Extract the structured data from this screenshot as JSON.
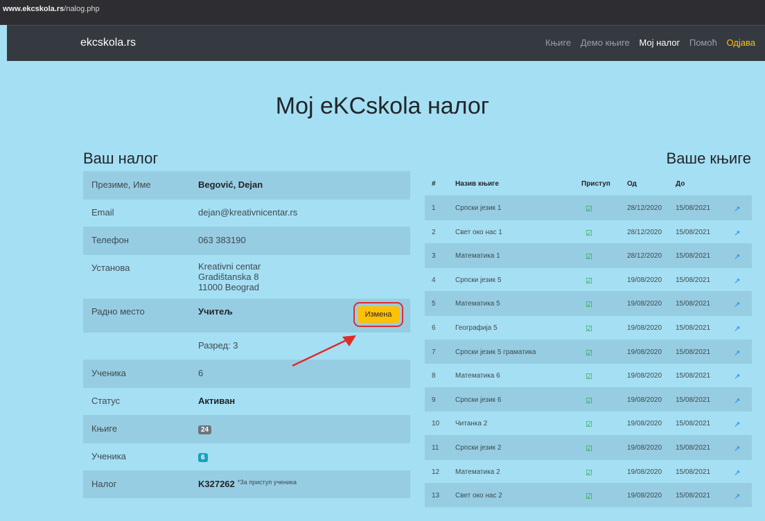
{
  "browser": {
    "url_host": "www.ekcskola.rs",
    "url_path": "/nalog.php"
  },
  "nav": {
    "brand": "ekcskola.rs",
    "links": [
      "Књиге",
      "Демо књиге",
      "Мој налог",
      "Помоћ",
      "Одјава"
    ]
  },
  "page": {
    "title": "Moj eKCskola налог"
  },
  "account": {
    "heading": "Ваш налог",
    "name_label": "Презиме, Име",
    "name": "Begović, Dejan",
    "email_label": "Email",
    "email": "dejan@kreativnicentar.rs",
    "phone_label": "Телефон",
    "phone": "063 383190",
    "inst_label": "Установа",
    "inst_lines": [
      "Kreativni centar",
      "Gradištanska 8",
      "11000 Beograd"
    ],
    "role_label": "Радно место",
    "role": "Учитељ",
    "edit_button": "Измена",
    "grade": "Разред: 3",
    "students_label": "Ученика",
    "students": "6",
    "status_label": "Статус",
    "status": "Активан",
    "books_label": "Књиге",
    "books_count": "24",
    "students2_label": "Ученика",
    "students2_count": "6",
    "account_label": "Налог",
    "account_code": "K327262",
    "account_note": "*За приступ ученика"
  },
  "books": {
    "heading": "Ваше књиге",
    "columns": [
      "#",
      "Назив књиге",
      "Приступ",
      "Од",
      "До"
    ],
    "rows": [
      {
        "n": "1",
        "title": "Српски језик 1",
        "from": "28/12/2020",
        "to": "15/08/2021"
      },
      {
        "n": "2",
        "title": "Свет око нас 1",
        "from": "28/12/2020",
        "to": "15/08/2021"
      },
      {
        "n": "3",
        "title": "Математика 1",
        "from": "28/12/2020",
        "to": "15/08/2021"
      },
      {
        "n": "4",
        "title": "Српски језик 5",
        "from": "19/08/2020",
        "to": "15/08/2021"
      },
      {
        "n": "5",
        "title": "Математика 5",
        "from": "19/08/2020",
        "to": "15/08/2021"
      },
      {
        "n": "6",
        "title": "Географија 5",
        "from": "19/08/2020",
        "to": "15/08/2021"
      },
      {
        "n": "7",
        "title": "Српски језик 5 граматика",
        "from": "19/08/2020",
        "to": "15/08/2021"
      },
      {
        "n": "8",
        "title": "Математика 6",
        "from": "19/08/2020",
        "to": "15/08/2021"
      },
      {
        "n": "9",
        "title": "Српски језик 6",
        "from": "19/08/2020",
        "to": "15/08/2021"
      },
      {
        "n": "10",
        "title": "Читанка 2",
        "from": "19/08/2020",
        "to": "15/08/2021"
      },
      {
        "n": "11",
        "title": "Српски језик 2",
        "from": "19/08/2020",
        "to": "15/08/2021"
      },
      {
        "n": "12",
        "title": "Математика 2",
        "from": "19/08/2020",
        "to": "15/08/2021"
      },
      {
        "n": "13",
        "title": "Свет око нас 2",
        "from": "19/08/2020",
        "to": "15/08/2021"
      }
    ]
  },
  "colors": {
    "background": "#a5dff3",
    "navbar": "#343a40",
    "accent": "#ffc107",
    "check": "#28a745",
    "chart": "#1e88e5"
  },
  "icons": {
    "access": "check-square-icon",
    "stats": "chart-line-icon"
  }
}
